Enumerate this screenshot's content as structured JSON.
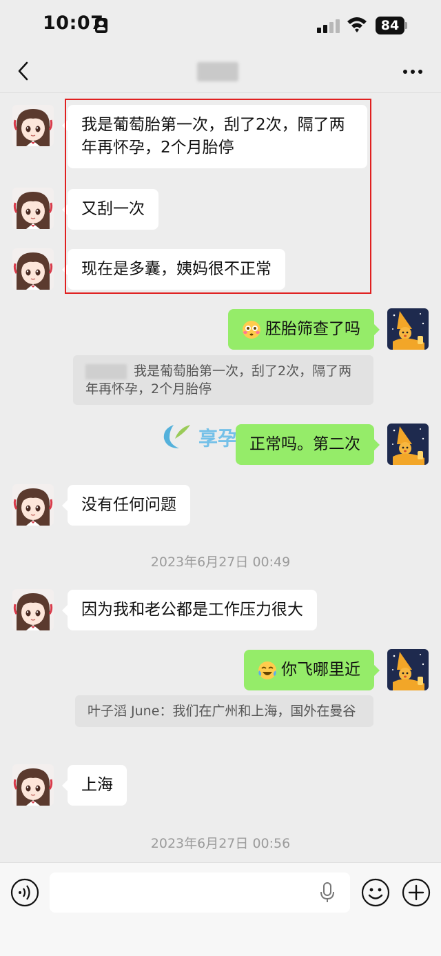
{
  "status_bar": {
    "time": "10:07",
    "battery": "84"
  },
  "messages": [
    {
      "from": "other",
      "text": "我是葡萄胎第一次，刮了2次，隔了两年再怀孕，2个月胎停"
    },
    {
      "from": "other",
      "text": "又刮一次"
    },
    {
      "from": "other",
      "text": "现在是多囊，姨妈很不正常"
    },
    {
      "from": "me",
      "emoji": "flushed-face-icon",
      "text": "胚胎筛查了吗",
      "quote": "我是葡萄胎第一次，刮了2次，隔了两年再怀孕，2个月胎停"
    },
    {
      "from": "me",
      "text": "正常吗。第二次"
    },
    {
      "from": "other",
      "text": "没有任何问题"
    },
    {
      "from": "timestamp",
      "text": "2023年6月27日 00:49"
    },
    {
      "from": "other",
      "text": "因为我和老公都是工作压力很大"
    },
    {
      "from": "me",
      "emoji": "tears-of-joy-icon",
      "text": "你飞哪里近",
      "quote": "叶子滔 June：我们在广州和上海，国外在曼谷"
    },
    {
      "from": "other",
      "text": "上海"
    },
    {
      "from": "timestamp",
      "text": "2023年6月27日 00:56"
    }
  ],
  "watermark": {
    "text": "享孕海外"
  },
  "colors": {
    "background": "#ededed",
    "my_bubble": "#95ec69",
    "other_bubble": "#ffffff",
    "highlight_border": "#e02020"
  }
}
